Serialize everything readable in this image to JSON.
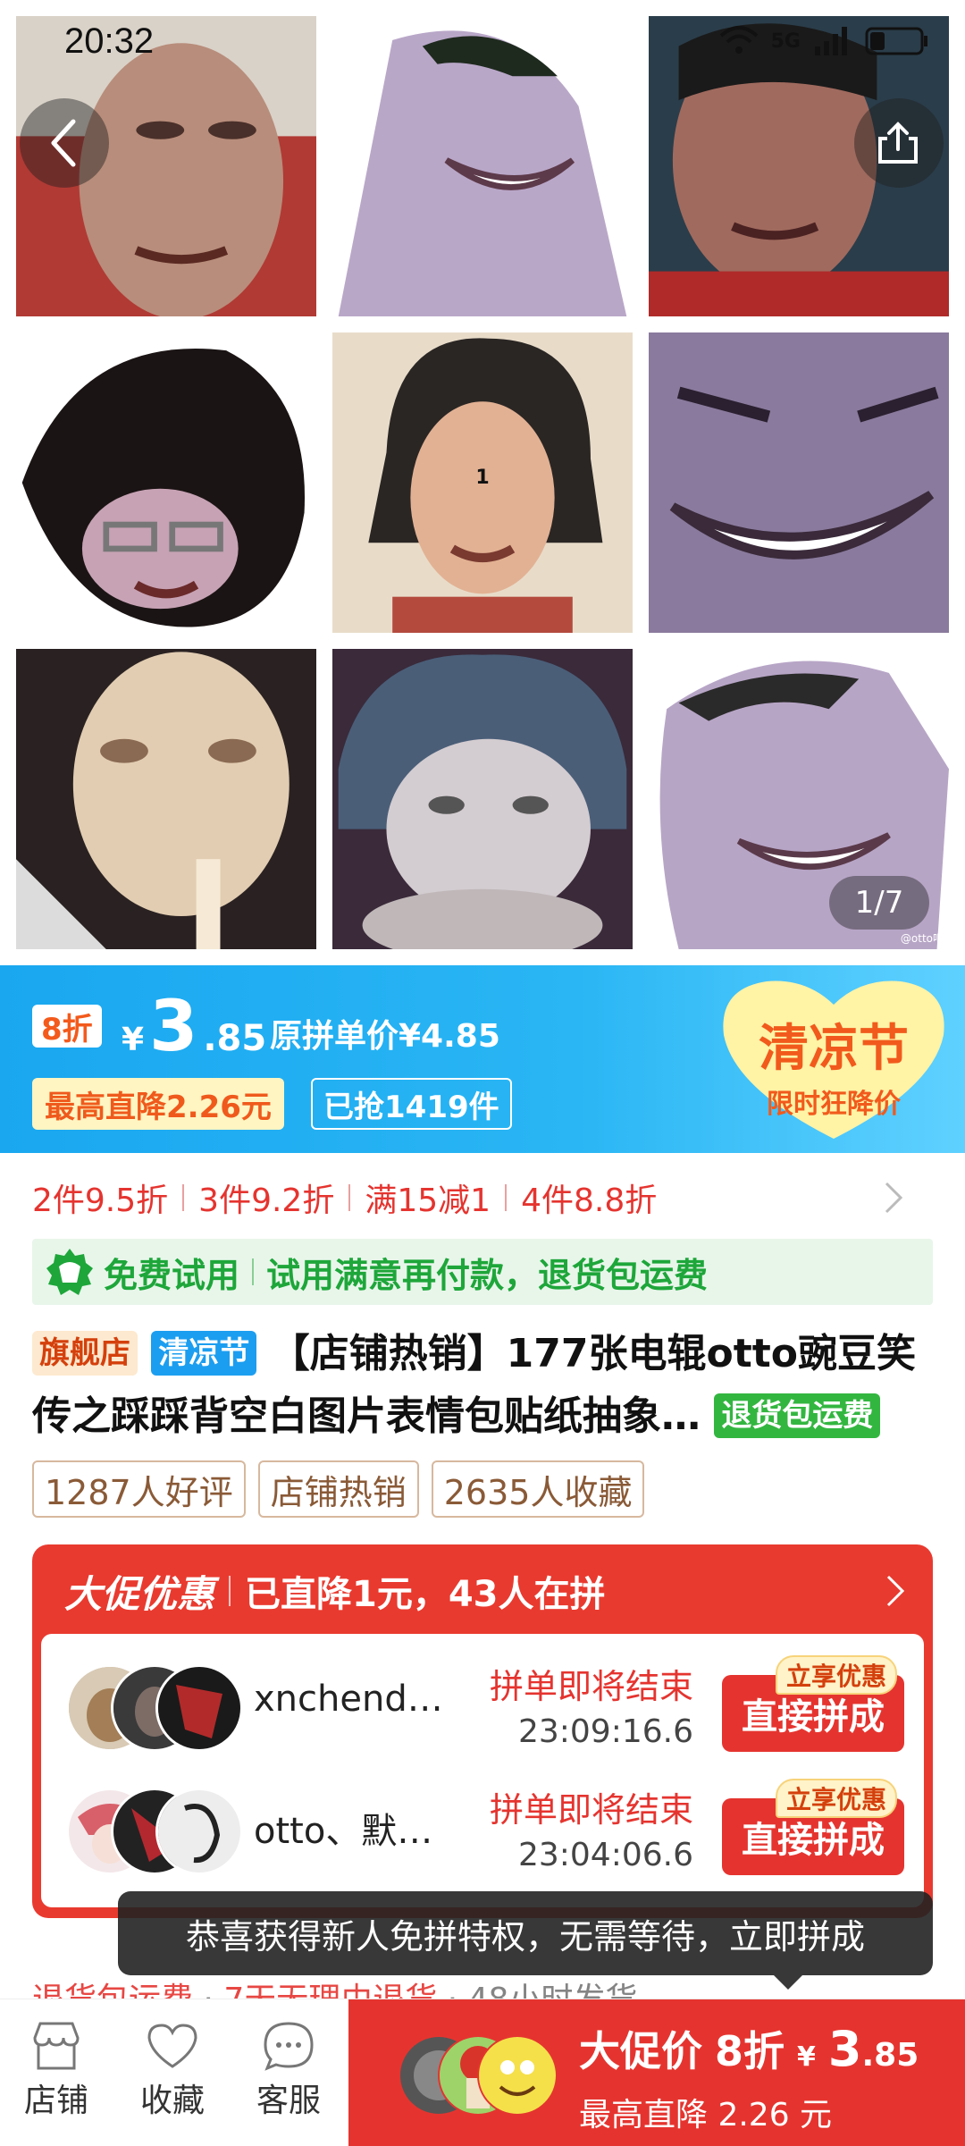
{
  "status_bar": {
    "time": "20:32",
    "network": "5G"
  },
  "gallery": {
    "page_indicator": "1/7",
    "center_label": "1",
    "watermark": "@otto吧"
  },
  "promo": {
    "discount_badge": "8折",
    "currency": "¥",
    "price_int": "3",
    "price_dec": ".85",
    "original_price": "原拼单价¥4.85",
    "max_drop": "最高直降2.26元",
    "sold": "已抢1419件",
    "festival_title": "清凉节",
    "festival_sub": "限时狂降价"
  },
  "tiers": [
    "2件9.5折",
    "3件9.2折",
    "满15减1",
    "4件8.8折"
  ],
  "trial": {
    "left": "免费试用",
    "right": "试用满意再付款，退货包运费"
  },
  "product": {
    "tag_store": "旗舰店",
    "tag_festival": "清凉节",
    "title": "【店铺热销】177张电辊otto豌豆笑传之踩踩背空白图片表情包贴纸抽象…",
    "tag_free_return": "退货包运费"
  },
  "chips": [
    "1287人好评",
    "店铺热销",
    "2635人收藏"
  ],
  "group": {
    "brand": "大促优惠",
    "desc": "已直降1元，43人在拼",
    "rows": [
      {
        "user": "xnchend…",
        "ends_label": "拼单即将结束",
        "countdown": "23:09:16.6",
        "tag": "立享优惠",
        "button": "直接拼成"
      },
      {
        "user": "otto、默…",
        "ends_label": "拼单即将结束",
        "countdown": "23:04:06.6",
        "tag": "立享优惠",
        "button": "直接拼成"
      }
    ]
  },
  "toast": "恭喜获得新人免拼特权，无需等待，立即拼成",
  "returns_line": {
    "a": "退货包运费",
    "b": "7天无理由退货",
    "c": "48小时发货"
  },
  "bottom": {
    "nav": [
      {
        "label": "店铺",
        "icon": "store-icon"
      },
      {
        "label": "收藏",
        "icon": "heart-icon"
      },
      {
        "label": "客服",
        "icon": "chat-icon"
      }
    ],
    "buy": {
      "label": "大促价",
      "discount": "8折",
      "currency": "¥",
      "price_int": "3",
      "price_dec": ".85",
      "sub": "最高直降 2.26 元"
    }
  },
  "colors": {
    "accent_red": "#e5342f",
    "promo_blue": "#1aa7f0",
    "trial_green": "#1ea63a"
  }
}
